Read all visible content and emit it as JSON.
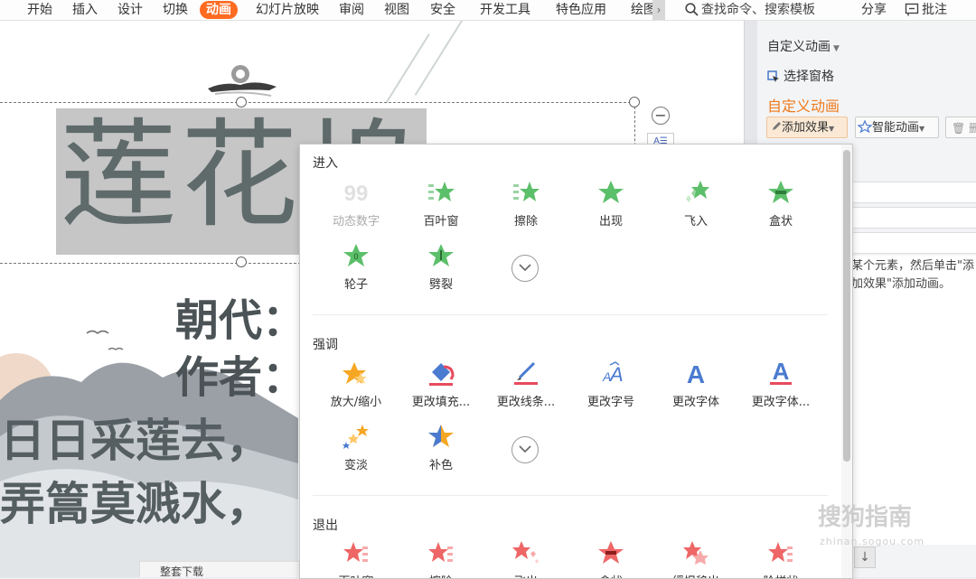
{
  "ribbon": {
    "tabs": [
      "开始",
      "插入",
      "设计",
      "切换",
      "动画",
      "幻灯片放映",
      "审阅",
      "视图",
      "安全",
      "开发工具",
      "特色应用",
      "绘图"
    ],
    "active_tab": "动画",
    "search_label": "查找命令、搜索模板",
    "share_label": "分享",
    "comment_label": "批注",
    "accent_color": "#ff6a21"
  },
  "slide": {
    "title": "莲花坞",
    "dynasty_label": "朝代：",
    "author_label": "作者：",
    "poem_line_1": "日日采莲去，",
    "poem_line_2": "弄篙莫溅水，",
    "small_tool_label": "A☰",
    "bottom_bar_label": "整套下载"
  },
  "task_pane": {
    "title": "自定义动画",
    "select_pane_label": "选择窗格",
    "heading": "自定义动画",
    "add_effect_label": "添加效果",
    "smart_anim_label": "智能动画",
    "delete_label": "删",
    "hint": "某个元素，然后单击\"添加效果\"添加动画。",
    "heading_color": "#ee7a1d"
  },
  "dropdown": {
    "sections": {
      "enter": {
        "title": "进入",
        "items": [
          {
            "label": "动态数字",
            "icon": "digits-icon",
            "disabled": true
          },
          {
            "label": "百叶窗",
            "icon": "blinds-star-icon"
          },
          {
            "label": "擦除",
            "icon": "wipe-star-icon"
          },
          {
            "label": "出现",
            "icon": "appear-star-icon"
          },
          {
            "label": "飞入",
            "icon": "fly-in-star-icon"
          },
          {
            "label": "盒状",
            "icon": "box-star-icon"
          },
          {
            "label": "轮子",
            "icon": "wheel-star-icon"
          },
          {
            "label": "劈裂",
            "icon": "split-star-icon"
          }
        ]
      },
      "emphasis": {
        "title": "强调",
        "items": [
          {
            "label": "放大/缩小",
            "icon": "grow-shrink-icon"
          },
          {
            "label": "更改填充...",
            "icon": "fill-bucket-icon"
          },
          {
            "label": "更改线条...",
            "icon": "line-color-icon"
          },
          {
            "label": "更改字号",
            "icon": "font-size-icon"
          },
          {
            "label": "更改字体",
            "icon": "font-icon"
          },
          {
            "label": "更改字体...",
            "icon": "font-color-icon"
          },
          {
            "label": "变淡",
            "icon": "fade-icon"
          },
          {
            "label": "补色",
            "icon": "complement-color-icon"
          }
        ]
      },
      "exit": {
        "title": "退出",
        "items": [
          {
            "label": "百叶窗",
            "icon": "exit-blinds-icon"
          },
          {
            "label": "擦除",
            "icon": "exit-wipe-icon"
          },
          {
            "label": "飞出",
            "icon": "exit-fly-out-icon"
          },
          {
            "label": "盒状",
            "icon": "exit-box-icon"
          },
          {
            "label": "缓慢移出",
            "icon": "exit-crawl-icon"
          },
          {
            "label": "阶梯状",
            "icon": "exit-steps-icon"
          }
        ]
      }
    },
    "enter_color": "#5cbf6a",
    "emphasis_color": "#f5a623",
    "exit_color": "#ee6666"
  },
  "watermark": {
    "text": "搜狗指南",
    "sub": "zhinan.sogou.com"
  }
}
